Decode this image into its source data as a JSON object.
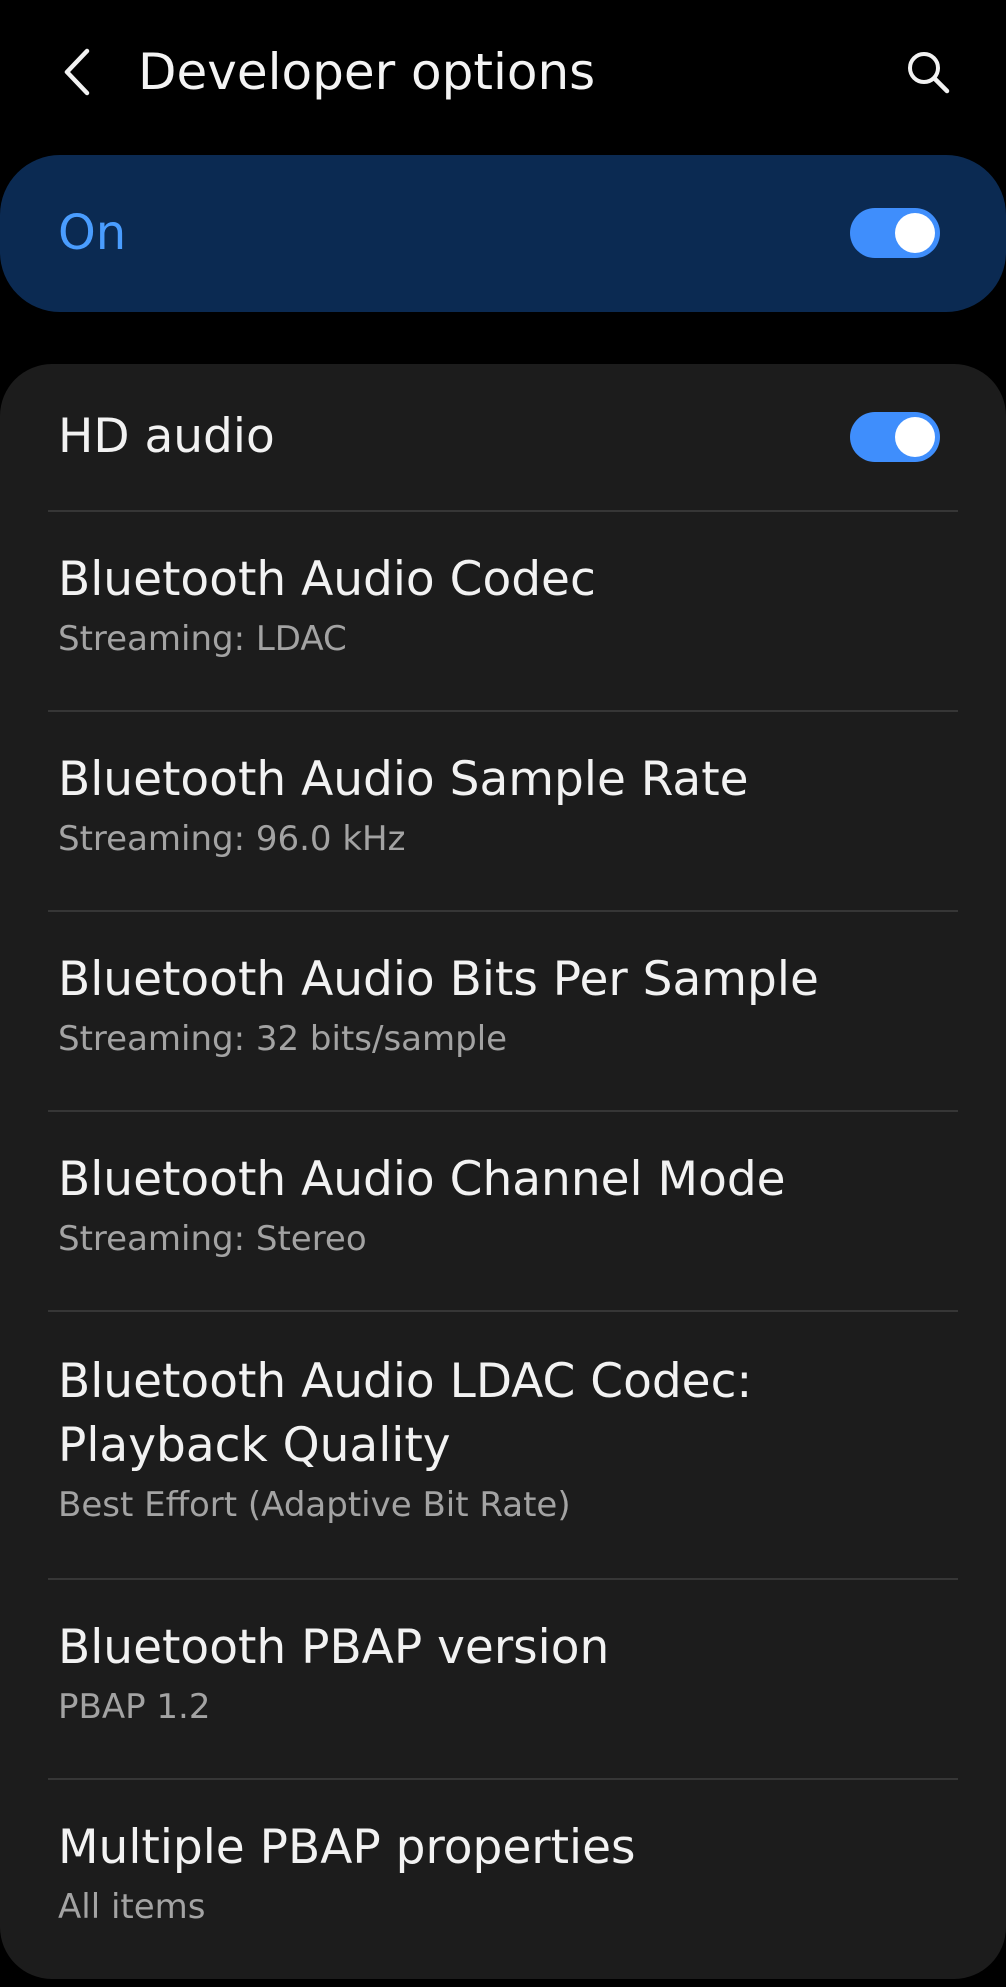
{
  "header": {
    "title": "Developer options",
    "back_icon": "chevron-left-icon",
    "search_icon": "search-icon"
  },
  "master_switch": {
    "label": "On",
    "state": true,
    "accent_color": "#3f8efc"
  },
  "settings": {
    "hd_audio": {
      "title": "HD audio",
      "state": true
    },
    "items": [
      {
        "title": "Bluetooth Audio Codec",
        "subtitle": "Streaming: LDAC"
      },
      {
        "title": "Bluetooth Audio Sample Rate",
        "subtitle": "Streaming: 96.0 kHz"
      },
      {
        "title": "Bluetooth Audio Bits Per Sample",
        "subtitle": "Streaming: 32 bits/sample"
      },
      {
        "title": "Bluetooth Audio Channel Mode",
        "subtitle": "Streaming: Stereo"
      },
      {
        "title_line1": "Bluetooth Audio LDAC Codec:",
        "title_line2": "Playback Quality",
        "subtitle": "Best Effort (Adaptive Bit Rate)"
      },
      {
        "title": "Bluetooth PBAP version",
        "subtitle": "PBAP 1.2"
      },
      {
        "title": "Multiple PBAP properties",
        "subtitle": "All items"
      }
    ]
  }
}
